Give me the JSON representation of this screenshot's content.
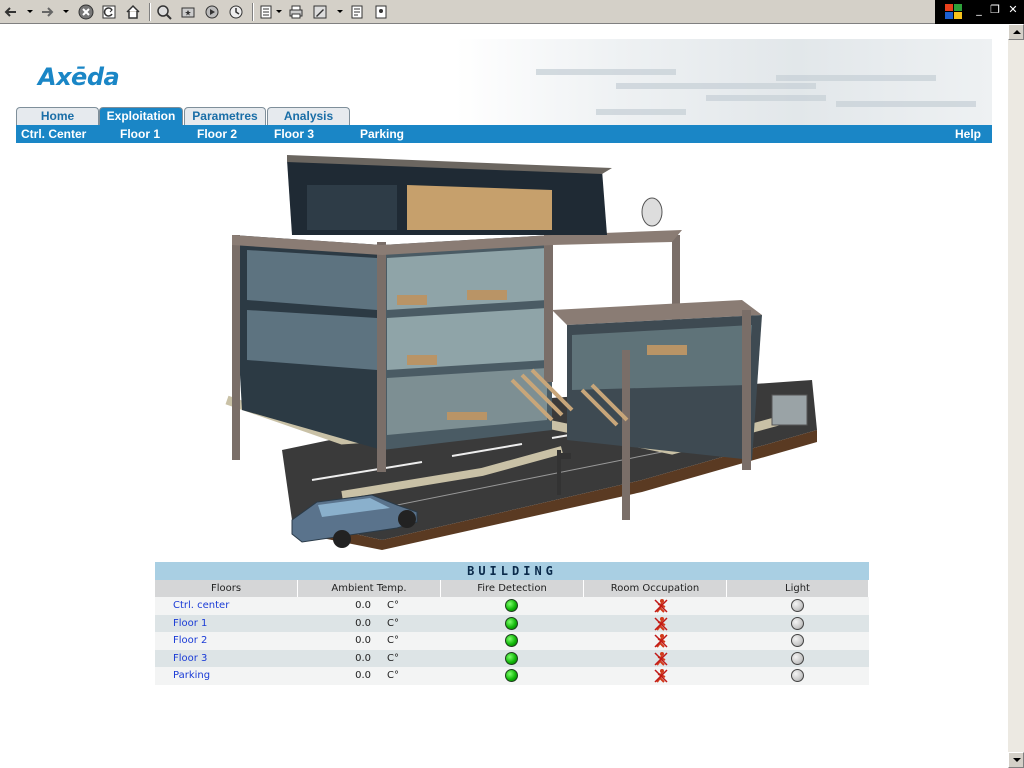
{
  "toolbar": {
    "buttons": [
      "back-icon",
      "forward-icon",
      "stop-icon",
      "refresh-icon",
      "home-icon",
      "search-icon",
      "favorites-icon",
      "media-icon",
      "history-icon",
      "mail-icon",
      "print-icon",
      "edit-icon",
      "discuss-icon",
      "messenger-icon"
    ]
  },
  "brand": {
    "logo_text": "Axēda",
    "accent_color": "#1a86c6"
  },
  "tabs": [
    {
      "label": "Home"
    },
    {
      "label": "Exploitation"
    },
    {
      "label": "Parametres"
    },
    {
      "label": "Analysis"
    }
  ],
  "subnav": {
    "items": [
      "Ctrl. Center",
      "Floor 1",
      "Floor 2",
      "Floor 3",
      "Parking"
    ],
    "help": "Help"
  },
  "table": {
    "title": "BUILDING",
    "headers": [
      "Floors",
      "Ambient Temp.",
      "Fire Detection",
      "Room Occupation",
      "Light"
    ],
    "rows": [
      {
        "floor": "Ctrl. center",
        "temp": "0.0",
        "unit": "C°",
        "fire": "green",
        "occupation": "unoccupied",
        "light": "off"
      },
      {
        "floor": "Floor 1",
        "temp": "0.0",
        "unit": "C°",
        "fire": "green",
        "occupation": "unoccupied",
        "light": "off"
      },
      {
        "floor": "Floor 2",
        "temp": "0.0",
        "unit": "C°",
        "fire": "green",
        "occupation": "unoccupied",
        "light": "off"
      },
      {
        "floor": "Floor 3",
        "temp": "0.0",
        "unit": "C°",
        "fire": "green",
        "occupation": "unoccupied",
        "light": "off"
      },
      {
        "floor": "Parking",
        "temp": "0.0",
        "unit": "C°",
        "fire": "green",
        "occupation": "unoccupied",
        "light": "off"
      }
    ]
  }
}
